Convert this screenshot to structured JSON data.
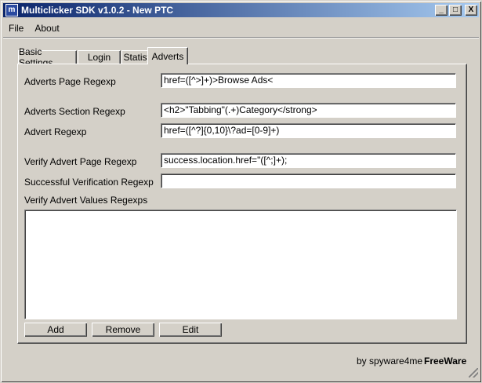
{
  "window": {
    "title": "Multiclicker SDK v1.0.2 - New PTC",
    "icon_letter": "m",
    "controls": {
      "minimize": "_",
      "maximize": "□",
      "close": "X"
    }
  },
  "menu": {
    "items": [
      "File",
      "About"
    ]
  },
  "tabs": [
    {
      "label": "Basic Settings",
      "active": false
    },
    {
      "label": "Login",
      "active": false
    },
    {
      "label": "Statistics",
      "active": false
    },
    {
      "label": "Adverts",
      "active": true
    }
  ],
  "form": {
    "adverts_page_regexp": {
      "label": "Adverts Page Regexp",
      "value": "href=([^>]+)>Browse Ads<"
    },
    "adverts_section_regexp": {
      "label": "Adverts Section Regexp",
      "value": "<h2>\"Tabbing\"(.+)Category</strong>"
    },
    "advert_regexp": {
      "label": "Advert Regexp",
      "value": "href=([^?]{0,10}\\?ad=[0-9]+)"
    },
    "verify_advert_page_regexp": {
      "label": "Verify Advert Page Regexp",
      "value": "success.location.href=\"([^;]+);"
    },
    "successful_verification_regexp": {
      "label": "Successful Verification Regexp",
      "value": ""
    },
    "verify_values": {
      "label": "Verify Advert Values Regexps",
      "value": ""
    }
  },
  "buttons": {
    "add": "Add",
    "remove": "Remove",
    "edit": "Edit"
  },
  "status": {
    "byline": "by spyware4me",
    "license": "FreeWare"
  }
}
